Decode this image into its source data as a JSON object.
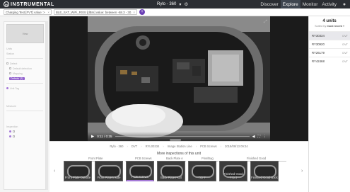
{
  "brand": {
    "name": "INSTRUMENTAL",
    "mark": "IN"
  },
  "station": {
    "label": "Rylo - 360",
    "dropdown": "▾"
  },
  "nav": {
    "items": [
      "Discover",
      "Explore",
      "Monitor",
      "Activity"
    ],
    "active": "Explore"
  },
  "filters": [
    {
      "label": "Charging Test [FVT] value: > 2.6V...",
      "remove": "×"
    },
    {
      "label": "BLE_SAT_WiFi_RSSI [dBm] value: between -68.3 - 30.2...",
      "remove": "×"
    }
  ],
  "sidebar": {
    "tile_label": "View",
    "rows": [
      "Units",
      "Station",
      "Defect",
      "Default detection",
      "Mapping",
      "Unit Tag",
      "Measure",
      "Inspection"
    ],
    "tag": "Defects (3)"
  },
  "player": {
    "time": "0:11 / 0:35",
    "icons": [
      "volume",
      "fullscreen",
      "more"
    ]
  },
  "breadcrumbs": [
    "Rylo - 360",
    "DVT",
    "RYL00334",
    "Image Station Line",
    "PCB Screws",
    "2019/09/13 09:24"
  ],
  "more_inspections": {
    "title": "More inspections of this unit",
    "steps": [
      "Front Plate",
      "PCB Screws",
      "Back Plate A",
      "Pins/Bag",
      "Finished Good"
    ],
    "thumbnails": [
      {
        "label": "Front Plate Outside"
      },
      {
        "label": "Front Plate Inside"
      },
      {
        "label": "PCB Screws",
        "active": true
      },
      {
        "label": "Back Plate PCB"
      },
      {
        "label": "TOFF"
      },
      {
        "label": "Finished Good Front"
      },
      {
        "label": "Finished Good Back"
      }
    ]
  },
  "units": {
    "count_label": "4 units",
    "sorted_prefix": "Sorted by",
    "sorted_value": "most recent",
    "sorted_arrow": "▾",
    "list": [
      {
        "id": "RY30334",
        "station": "DVT",
        "active": true
      },
      {
        "id": "RY30920",
        "station": "DVT"
      },
      {
        "id": "RY26179",
        "station": "DVT"
      },
      {
        "id": "RY42468",
        "station": "DVT"
      }
    ]
  },
  "colors": {
    "accent": "#6b3fb5",
    "topbar": "#2b2e33"
  }
}
